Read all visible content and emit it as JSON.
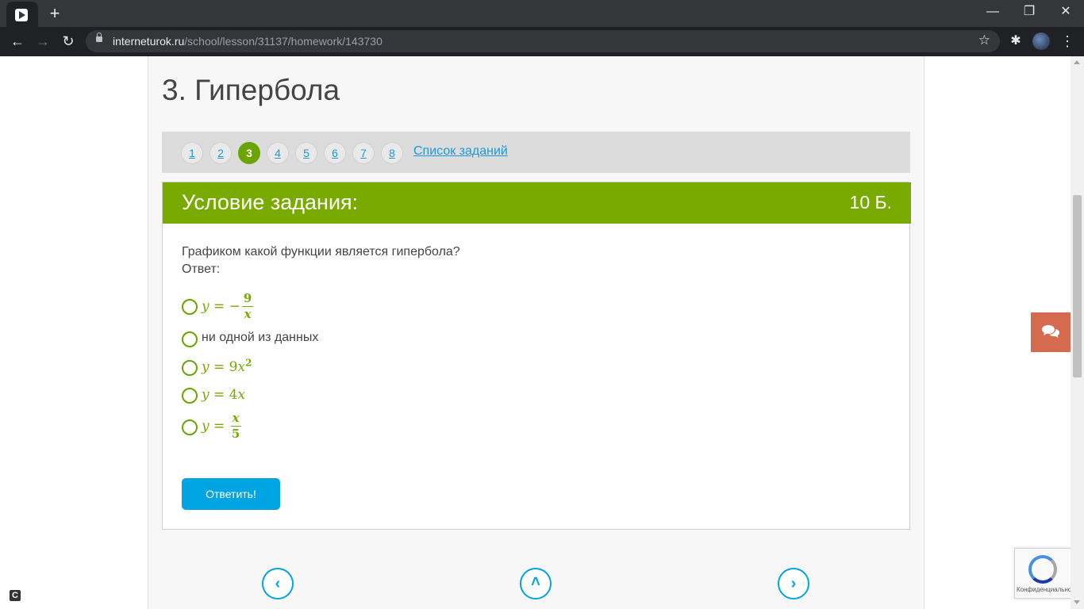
{
  "browser": {
    "url_host": "interneturok.ru",
    "url_path": "/school/lesson/31137/homework/143730",
    "window_controls": {
      "minimize": "—",
      "restore": "❐",
      "close": "✕"
    }
  },
  "page": {
    "title": "3. Гипербола",
    "task_numbers": [
      "1",
      "2",
      "3",
      "4",
      "5",
      "6",
      "7",
      "8"
    ],
    "active_task": "3",
    "task_list_link": "Список заданий"
  },
  "task": {
    "header_title": "Условие задания:",
    "points": "10 Б.",
    "question": "Графиком какой функции является гипербола?",
    "answer_label": "Ответ:",
    "options": [
      {
        "type": "math",
        "text": "y = −9/x"
      },
      {
        "type": "text",
        "text": "ни одной из данных"
      },
      {
        "type": "math",
        "text": "y = 9x²"
      },
      {
        "type": "math",
        "text": "y = 4x"
      },
      {
        "type": "math",
        "text": "y = x/5"
      }
    ],
    "submit_label": "Ответить!"
  },
  "recaptcha": {
    "text": "Конфиденциальность"
  },
  "colors": {
    "accent_green": "#78aa00",
    "link_blue": "#1a9ad6",
    "button_blue": "#00a4e3",
    "chat_orange": "#d46a4e"
  },
  "icons": {
    "prev": "chevron-left-icon",
    "up": "chevron-up-icon",
    "next": "chevron-right-icon",
    "chat": "chat-icon"
  }
}
